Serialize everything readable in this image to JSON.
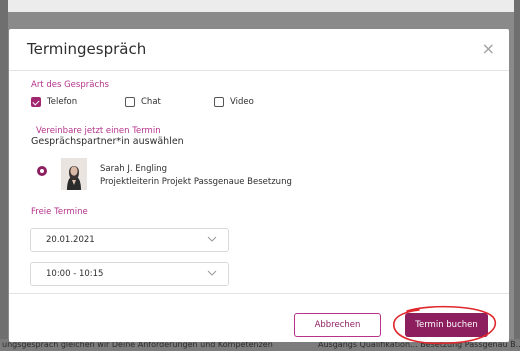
{
  "background": {
    "text_left": "ungsgespräch gleichen wir Deine Anforderungen und Kompetenzen",
    "text_right": "Ausgangs Qualifikation... Besetzung Passgenau B..."
  },
  "modal": {
    "title": "Termingespräch",
    "close_symbol": "×"
  },
  "conversation_type": {
    "label": "Art des Gesprächs",
    "options": [
      {
        "label": "Telefon",
        "checked": true
      },
      {
        "label": "Chat",
        "checked": false
      },
      {
        "label": "Video",
        "checked": false
      }
    ]
  },
  "appointment": {
    "label": "Vereinbare jetzt einen Termin",
    "partner_heading": "Gesprächspartner*in auswählen",
    "partner": {
      "name": "Sarah J. Engling",
      "role": "Projektleiterin Projekt Passgenaue Besetzung",
      "selected": true
    }
  },
  "slots": {
    "label": "Freie Termine",
    "date": "20.01.2021",
    "time": "10:00 - 10:15"
  },
  "footer": {
    "cancel_label": "Abbrechen",
    "book_label": "Termin buchen"
  },
  "colors": {
    "accent": "#8d1f5f",
    "label_accent": "#b5338a",
    "annotation": "#e0282c"
  }
}
